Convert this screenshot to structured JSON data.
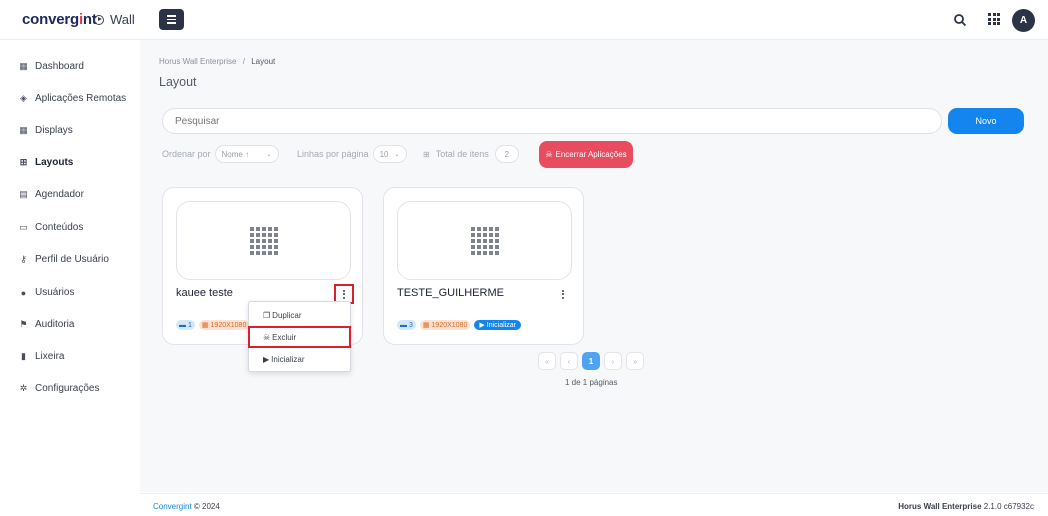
{
  "header": {
    "brand_left": "converg",
    "brand_accent": "i",
    "brand_right": "nt",
    "product": "Wall",
    "avatar_initial": "A"
  },
  "sidebar": {
    "items": [
      {
        "label": "Dashboard",
        "icon": "dashboard-icon"
      },
      {
        "label": "Aplicações Remotas",
        "icon": "remote-apps-icon"
      },
      {
        "label": "Displays",
        "icon": "displays-icon"
      },
      {
        "label": "Layouts",
        "icon": "layouts-icon"
      },
      {
        "label": "Agendador",
        "icon": "calendar-icon"
      },
      {
        "label": "Conteúdos",
        "icon": "content-icon"
      },
      {
        "label": "Perfil de Usuário",
        "icon": "key-icon"
      },
      {
        "label": "Usuários",
        "icon": "users-icon"
      },
      {
        "label": "Auditoria",
        "icon": "flag-icon"
      },
      {
        "label": "Lixeira",
        "icon": "trash-icon"
      },
      {
        "label": "Configurações",
        "icon": "gear-icon"
      }
    ],
    "active": "Layouts"
  },
  "breadcrumb": {
    "root": "Horus Wall Enterprise",
    "sep": "/",
    "current": "Layout"
  },
  "page_title": "Layout",
  "search": {
    "placeholder": "Pesquisar"
  },
  "new_button": "Novo",
  "filters": {
    "order_label": "Ordenar por",
    "order_value": "Nome ↑",
    "rows_label": "Linhas por página",
    "rows_value": "10",
    "total_label": "Total de itens",
    "total_value": "2"
  },
  "end_apps_button": "Encerrar Aplicações",
  "cards": [
    {
      "title": "kauee teste",
      "displays": "1",
      "resolution": "1920X1080"
    },
    {
      "title": "TESTE_GUILHERME",
      "displays": "3",
      "resolution": "1920X1080",
      "start_label": "Inicializar"
    }
  ],
  "dropdown": {
    "duplicate": "Duplicar",
    "delete": "Excluir",
    "start": "Inicializar"
  },
  "pagination": {
    "first": "«",
    "prev": "‹",
    "current": "1",
    "next": "›",
    "last": "»",
    "info": "1 de 1 páginas"
  },
  "footer": {
    "left_brand": "Convergint",
    "left_rest": " © 2024",
    "right_product": "Horus Wall Enterprise",
    "right_version": " 2.1.0 c67932c"
  },
  "colors": {
    "primary": "#1485ee",
    "danger": "#e84d5f",
    "highlight": "#d8202f",
    "dark": "#2c3346"
  }
}
